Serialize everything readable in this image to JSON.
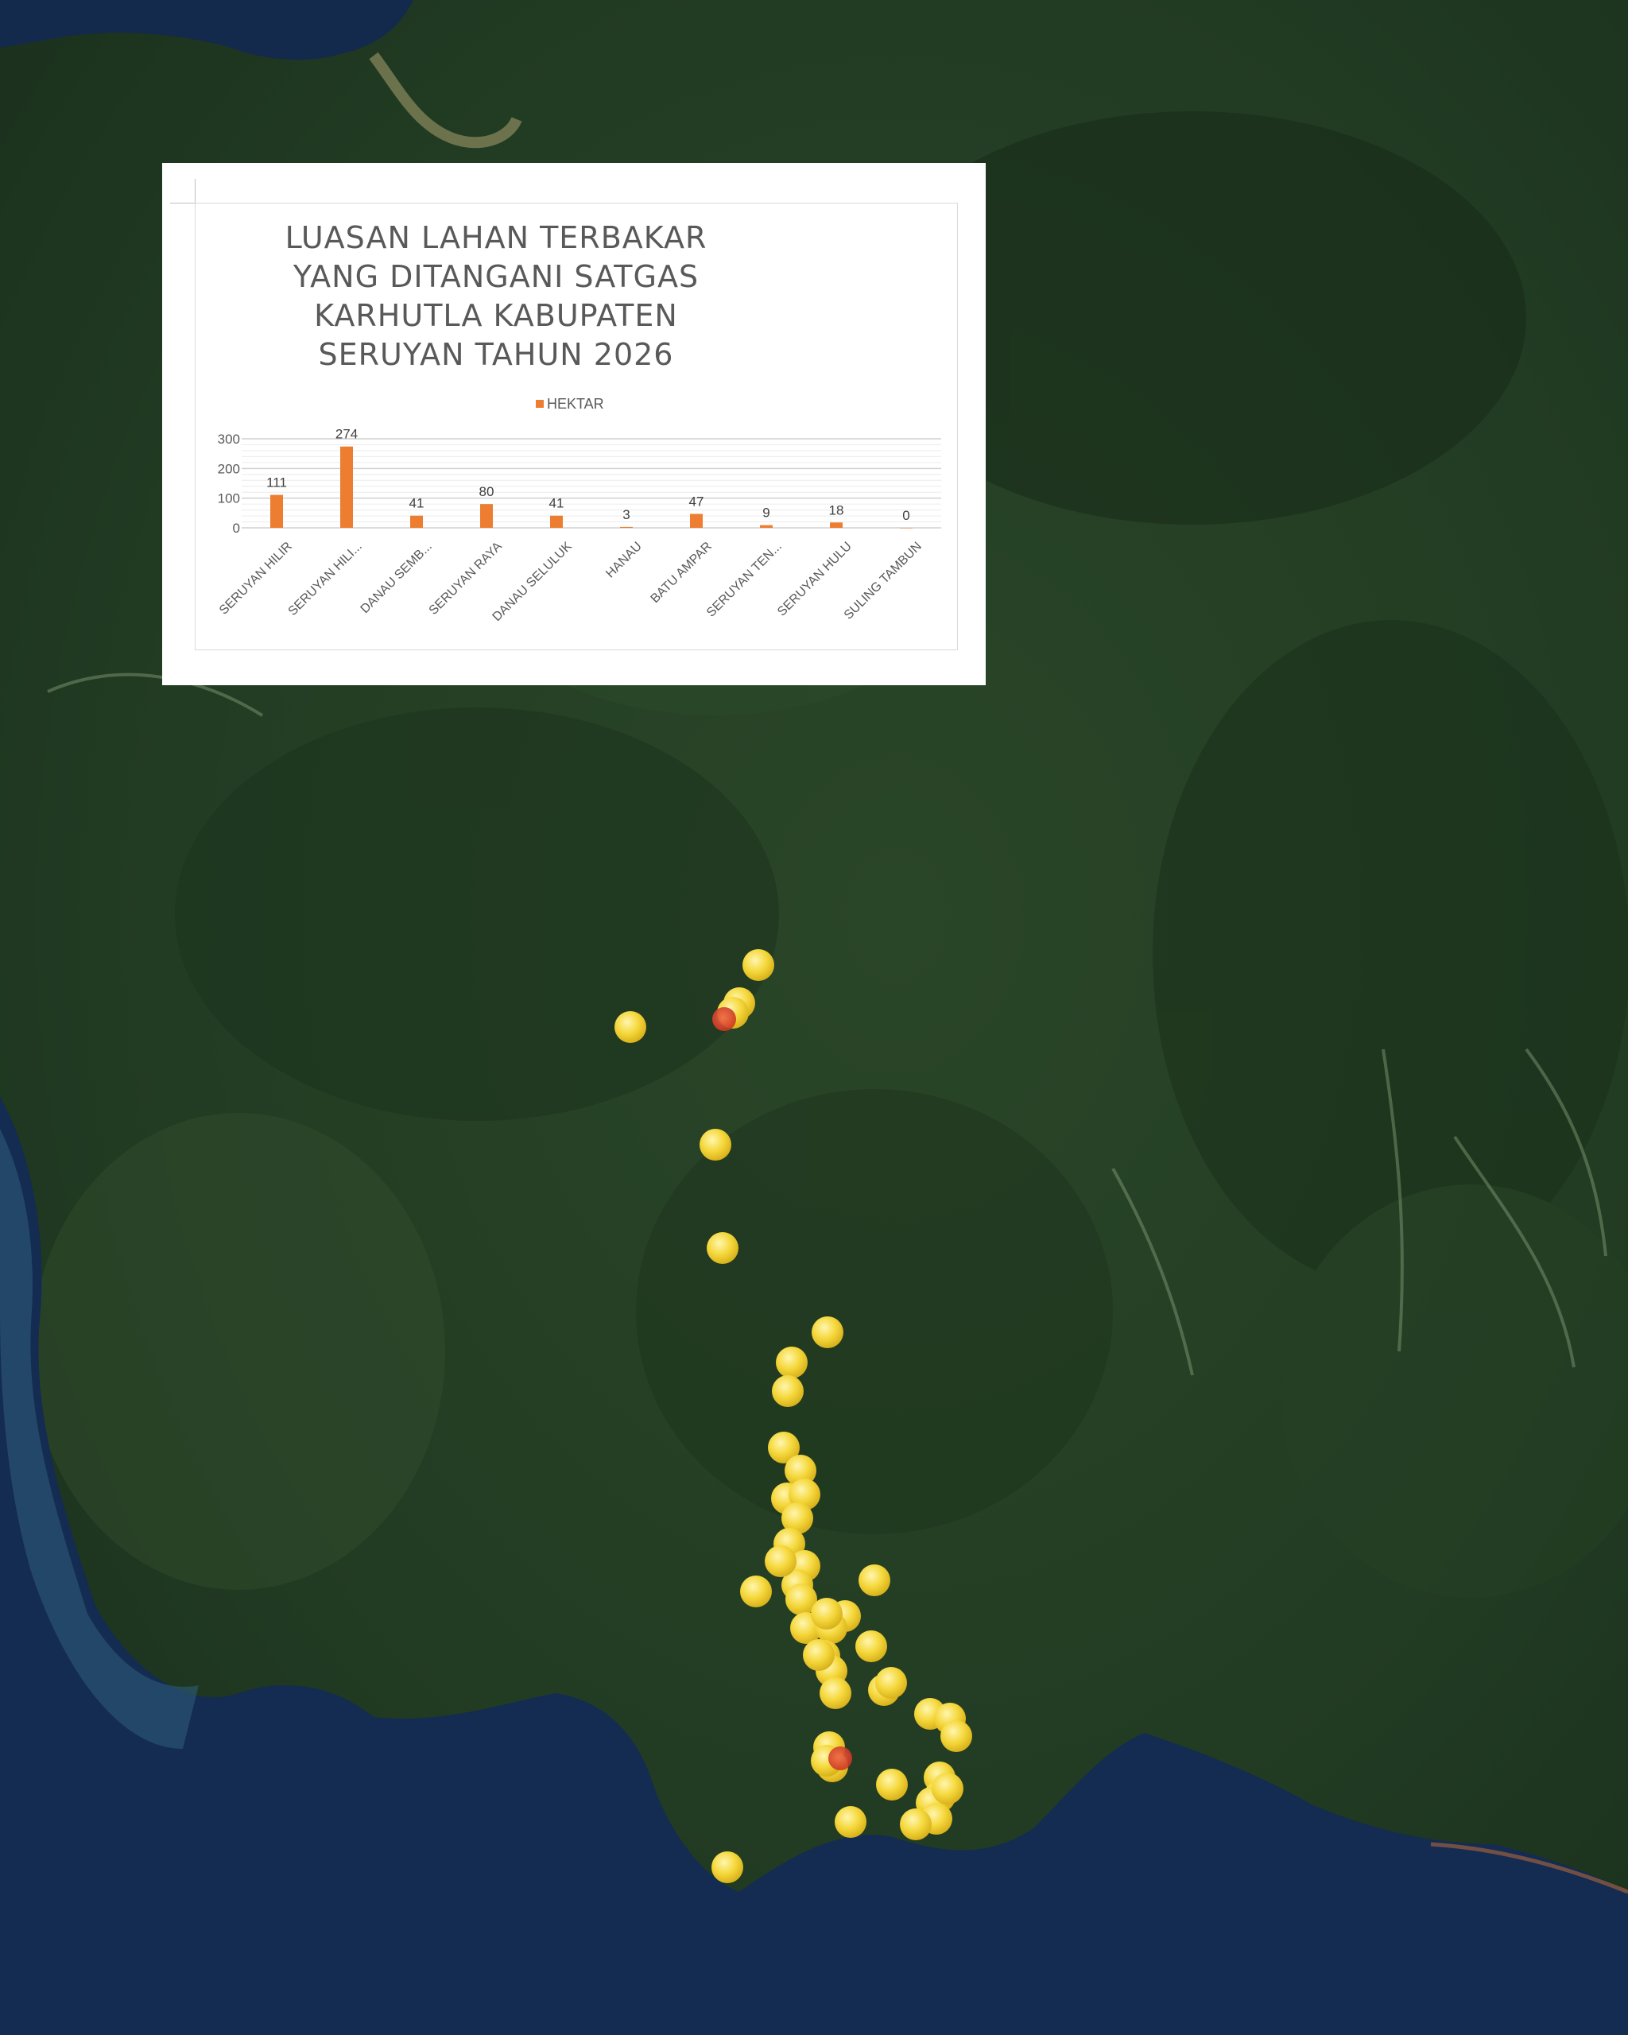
{
  "map": {
    "colors": {
      "forest_dark": "#1b301d",
      "forest_mid": "#2c4a2b",
      "sea": "#13294f",
      "sea_shallow": "#2f5e7c",
      "hotspot": "#f3d23a",
      "hotspot_red": "#d93a26"
    },
    "hotspot_count": 47
  },
  "chart": {
    "title": "LUASAN LAHAN TERBAKAR YANG DITANGANI SATGAS KARHUTLA KABUPATEN SERUYAN TAHUN 2026",
    "legend_label": "HEKTAR"
  },
  "chart_data": {
    "type": "bar",
    "title": "LUASAN LAHAN TERBAKAR YANG DITANGANI SATGAS KARHUTLA KABUPATEN SERUYAN TAHUN 2026",
    "categories": [
      "SERUYAN HILIR",
      "SERUYAN HILI...",
      "DANAU SEMB...",
      "SERUYAN RAYA",
      "DANAU SELULUK",
      "HANAU",
      "BATU AMPAR",
      "SERUYAN TEN...",
      "SERUYAN HULU",
      "SULING TAMBUN"
    ],
    "series": [
      {
        "name": "HEKTAR",
        "values": [
          111,
          274,
          41,
          80,
          41,
          3,
          47,
          9,
          18,
          0
        ],
        "color": "#ED7D31"
      }
    ],
    "ylim": [
      0,
      300
    ],
    "yticks": [
      0,
      100,
      200,
      300
    ],
    "xlabel": "",
    "ylabel": "",
    "grid": true,
    "legend": "top"
  }
}
